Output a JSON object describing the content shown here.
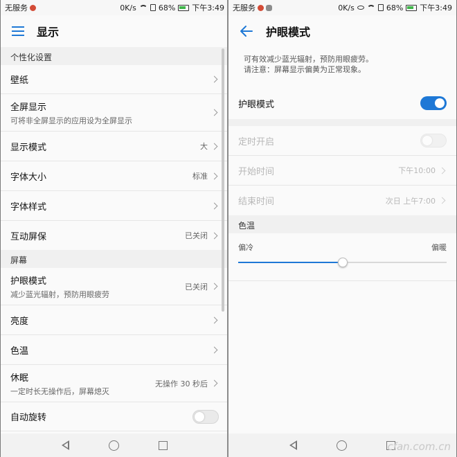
{
  "status_left": {
    "carrier": "无服务",
    "time_text": "下午3:49",
    "speed": "0K/s",
    "battery": "68%"
  },
  "status_right": {
    "carrier": "无服务",
    "time_text": "下午3:49",
    "speed": "0K/s",
    "battery": "68%"
  },
  "left": {
    "title": "显示",
    "sections": [
      {
        "header": "个性化设置",
        "items": [
          {
            "label": "壁纸",
            "sub": "",
            "value": ""
          },
          {
            "label": "全屏显示",
            "sub": "可将非全屏显示的应用设为全屏显示",
            "value": ""
          },
          {
            "label": "显示模式",
            "sub": "",
            "value": "大"
          },
          {
            "label": "字体大小",
            "sub": "",
            "value": "标准"
          },
          {
            "label": "字体样式",
            "sub": "",
            "value": ""
          },
          {
            "label": "互动屏保",
            "sub": "",
            "value": "已关闭"
          }
        ]
      },
      {
        "header": "屏幕",
        "items": [
          {
            "label": "护眼模式",
            "sub": "减少蓝光辐射，预防用眼疲劳",
            "value": "已关闭"
          },
          {
            "label": "亮度",
            "sub": "",
            "value": ""
          },
          {
            "label": "色温",
            "sub": "",
            "value": ""
          },
          {
            "label": "休眠",
            "sub": "一定时长无操作后，屏幕熄灭",
            "value": "无操作 30 秒后"
          },
          {
            "label": "自动旋转",
            "sub": "",
            "value": "",
            "toggle": false
          }
        ]
      }
    ]
  },
  "right": {
    "title": "护眼模式",
    "description_line1": "可有效减少蓝光辐射，预防用眼疲劳。",
    "description_line2": "请注意：屏幕显示偏黄为正常现象。",
    "eye_mode_label": "护眼模式",
    "eye_mode_on": true,
    "schedule_label": "定时开启",
    "schedule_on": false,
    "start_label": "开始时间",
    "start_value": "下午10:00",
    "end_label": "结束时间",
    "end_value": "次日 上午7:00",
    "temp_header": "色温",
    "temp_cool": "偏冷",
    "temp_warm": "偏暖",
    "temp_level": 0.5
  },
  "watermark": "cfan.com.cn",
  "colors": {
    "accent": "#1e78d6",
    "battery": "#3fb54a",
    "notify": "#d34b36"
  }
}
